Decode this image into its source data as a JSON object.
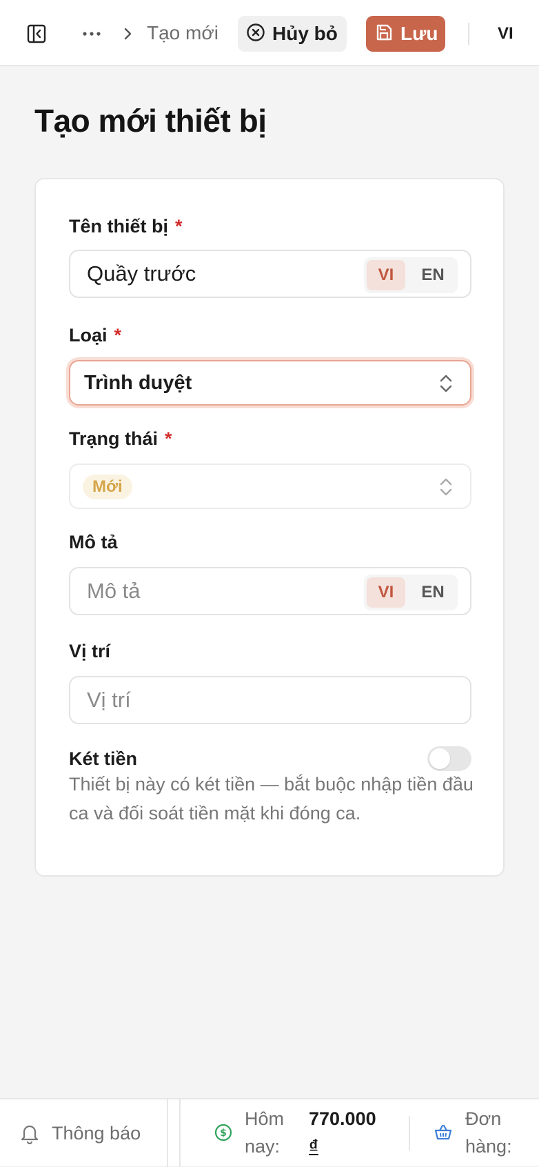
{
  "header": {
    "breadcrumb_current": "Tạo mới",
    "cancel_label": "Hủy bỏ",
    "save_label": "Lưu",
    "language": "VI"
  },
  "page": {
    "title": "Tạo mới thiết bị"
  },
  "form": {
    "name": {
      "label": "Tên thiết bị",
      "required_mark": "*",
      "value": "Quầy trước",
      "lang_active": "VI",
      "lang_other": "EN"
    },
    "type": {
      "label": "Loại",
      "required_mark": "*",
      "value": "Trình duyệt"
    },
    "status": {
      "label": "Trạng thái",
      "required_mark": "*",
      "value": "Mới"
    },
    "description": {
      "label": "Mô tả",
      "placeholder": "Mô tả",
      "lang_active": "VI",
      "lang_other": "EN"
    },
    "location": {
      "label": "Vị trí",
      "placeholder": "Vị trí"
    },
    "cash_drawer": {
      "label": "Két tiền",
      "enabled": false,
      "help": "Thiết bị này có két tiền — bắt buộc nhập tiền đầu ca và đối soát tiền mặt khi đóng ca."
    }
  },
  "footer": {
    "notifications_label": "Thông báo",
    "today_label_line1": "Hôm",
    "today_label_line2": "nay:",
    "today_value_line1": "770.000",
    "today_value_line2": "₫",
    "orders_label_line1": "Đơn",
    "orders_label_line2": "hàng:"
  },
  "colors": {
    "accent": "#c8664c",
    "required": "#d22d2d",
    "status_badge_bg": "#fbf3e2",
    "status_badge_text": "#d5a54a",
    "money_icon": "#2fa35a",
    "basket_icon": "#3b7dd8"
  }
}
